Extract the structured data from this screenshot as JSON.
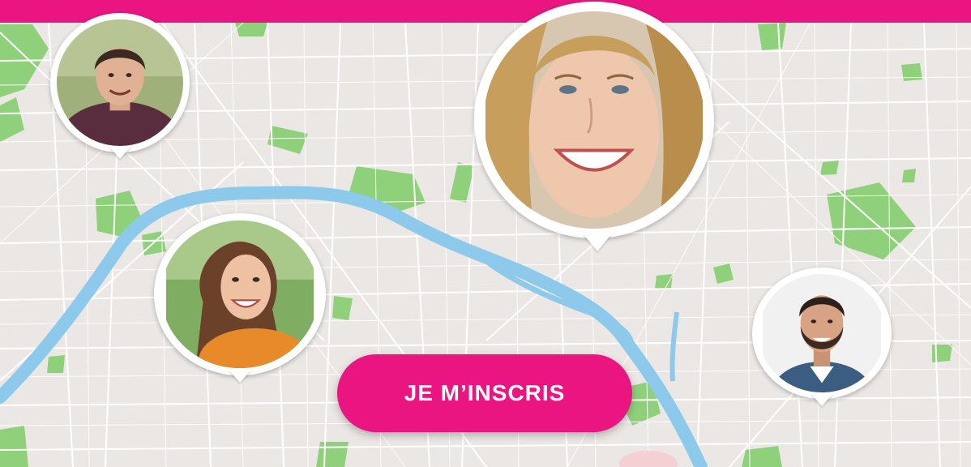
{
  "colors": {
    "brand_pink": "#ea1580",
    "map_background": "#ebe7e5",
    "river_blue": "#8cc9ea",
    "park_green": "#8fd17a",
    "street_white": "#ffffff"
  },
  "map": {
    "icon": "city-map-background"
  },
  "profiles": [
    {
      "name": "profile-pin-man-selfie",
      "icon": "man-selfie-photo"
    },
    {
      "name": "profile-pin-woman-blonde",
      "icon": "woman-blonde-smiling-photo"
    },
    {
      "name": "profile-pin-woman-brunette",
      "icon": "woman-brunette-smiling-photo"
    },
    {
      "name": "profile-pin-man-beard",
      "icon": "man-beard-smiling-photo"
    }
  ],
  "cta": {
    "label": "JE M’INSCRIS"
  }
}
